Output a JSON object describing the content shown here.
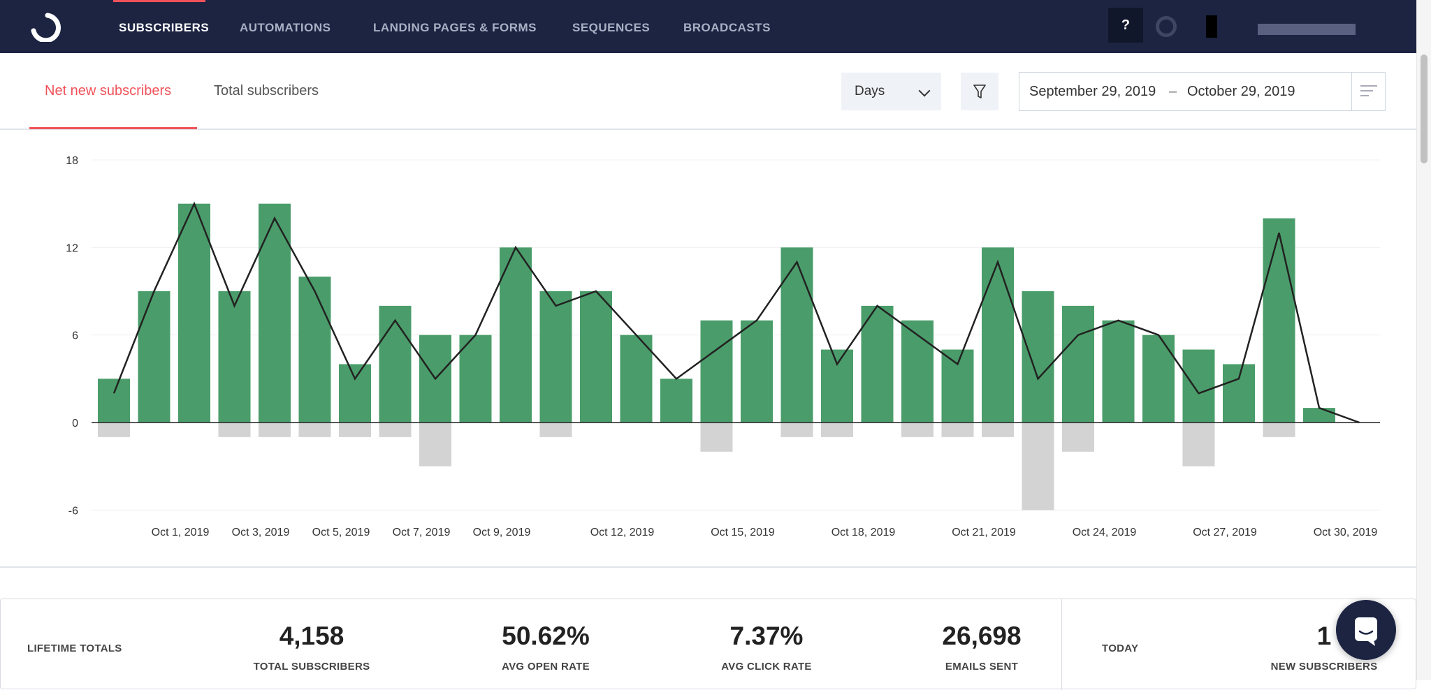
{
  "nav": {
    "items": [
      {
        "label": "SUBSCRIBERS",
        "active": true
      },
      {
        "label": "AUTOMATIONS"
      },
      {
        "label": "LANDING PAGES & FORMS"
      },
      {
        "label": "SEQUENCES"
      },
      {
        "label": "BROADCASTS"
      }
    ],
    "help_label": "?"
  },
  "tabs": [
    {
      "label": "Net new subscribers",
      "active": true
    },
    {
      "label": "Total subscribers"
    }
  ],
  "controls": {
    "interval": "Days",
    "date_start": "September 29, 2019",
    "date_sep": "–",
    "date_end": "October 29, 2019"
  },
  "colors": {
    "nav_bg": "#1c2442",
    "accent": "#f0525a",
    "positive_bar": "#4a9d6a",
    "negative_bar": "#d3d3d3",
    "line": "#222222"
  },
  "chart_data": {
    "type": "bar",
    "ylim": [
      -6,
      18
    ],
    "yticks": [
      18,
      12,
      6,
      0,
      -6
    ],
    "grid": true,
    "categories": [
      "Sep 29",
      "Sep 30",
      "Oct 1",
      "Oct 2",
      "Oct 3",
      "Oct 4",
      "Oct 5",
      "Oct 6",
      "Oct 7",
      "Oct 8",
      "Oct 9",
      "Oct 10",
      "Oct 11",
      "Oct 12",
      "Oct 13",
      "Oct 14",
      "Oct 15",
      "Oct 16",
      "Oct 17",
      "Oct 18",
      "Oct 19",
      "Oct 20",
      "Oct 21",
      "Oct 22",
      "Oct 23",
      "Oct 24",
      "Oct 25",
      "Oct 26",
      "Oct 27",
      "Oct 28",
      "Oct 29",
      "Oct 30"
    ],
    "xtick_labels": [
      {
        "index": 2,
        "label": "Oct 1, 2019"
      },
      {
        "index": 4,
        "label": "Oct 3, 2019"
      },
      {
        "index": 6,
        "label": "Oct 5, 2019"
      },
      {
        "index": 8,
        "label": "Oct 7, 2019"
      },
      {
        "index": 10,
        "label": "Oct 9, 2019"
      },
      {
        "index": 13,
        "label": "Oct 12, 2019"
      },
      {
        "index": 16,
        "label": "Oct 15, 2019"
      },
      {
        "index": 19,
        "label": "Oct 18, 2019"
      },
      {
        "index": 22,
        "label": "Oct 21, 2019"
      },
      {
        "index": 25,
        "label": "Oct 24, 2019"
      },
      {
        "index": 28,
        "label": "Oct 27, 2019"
      },
      {
        "index": 31,
        "label": "Oct 30, 2019"
      }
    ],
    "series": [
      {
        "type": "bar",
        "values": [
          3,
          9,
          15,
          9,
          15,
          10,
          4,
          8,
          6,
          6,
          12,
          9,
          9,
          6,
          3,
          7,
          7,
          12,
          5,
          8,
          7,
          5,
          12,
          9,
          8,
          7,
          6,
          5,
          4,
          14,
          1,
          0
        ]
      },
      {
        "type": "bar",
        "values": [
          -1,
          0,
          0,
          -1,
          -1,
          -1,
          -1,
          -1,
          -3,
          0,
          0,
          -1,
          0,
          0,
          0,
          -2,
          0,
          -1,
          -1,
          0,
          -1,
          -1,
          -1,
          -6,
          -2,
          0,
          0,
          -3,
          0,
          -1,
          0,
          0
        ]
      },
      {
        "type": "line",
        "values": [
          2,
          9,
          15,
          8,
          14,
          9,
          3,
          7,
          3,
          6,
          12,
          8,
          9,
          6,
          3,
          5,
          7,
          11,
          4,
          8,
          6,
          4,
          11,
          3,
          6,
          7,
          6,
          2,
          3,
          13,
          1,
          0
        ]
      }
    ]
  },
  "stats": {
    "lifetime_label": "LIFETIME TOTALS",
    "items": [
      {
        "value": "4,158",
        "label": "TOTAL SUBSCRIBERS"
      },
      {
        "value": "50.62%",
        "label": "AVG OPEN RATE"
      },
      {
        "value": "7.37%",
        "label": "AVG CLICK RATE"
      },
      {
        "value": "26,698",
        "label": "EMAILS SENT"
      }
    ],
    "today_label": "TODAY",
    "today": {
      "value": "1",
      "label": "NEW SUBSCRIBERS"
    }
  }
}
